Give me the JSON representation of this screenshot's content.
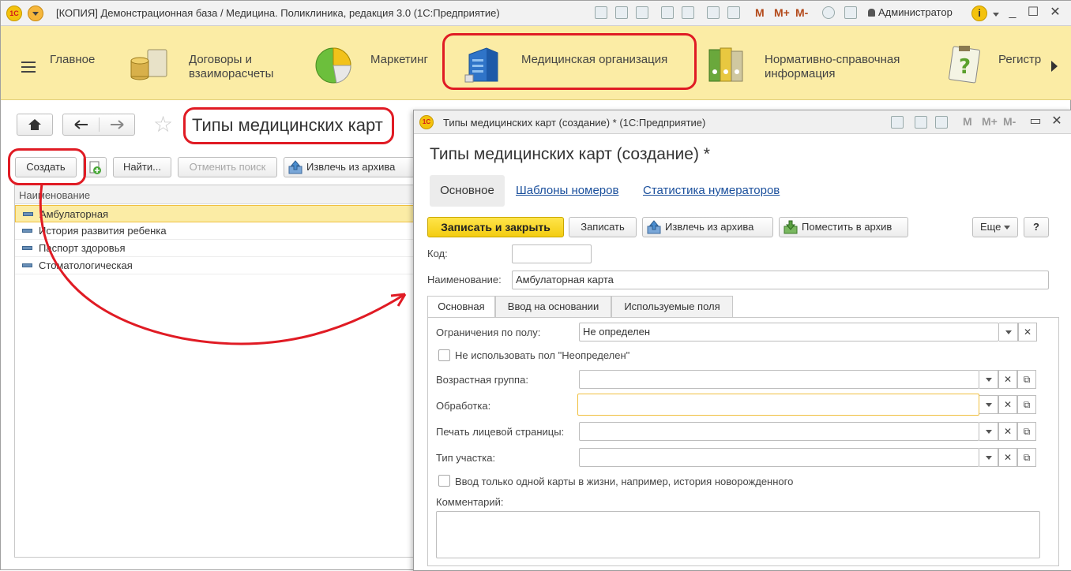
{
  "window": {
    "title": "[КОПИЯ] Демонстрационная база / Медицина. Поликлиника, редакция 3.0  (1С:Предприятие)",
    "user": "Администратор",
    "m_labels": [
      "M",
      "M+",
      "M-"
    ]
  },
  "sections": {
    "items": [
      {
        "label_line1": "Главное",
        "label_line2": ""
      },
      {
        "label_line1": "Договоры и",
        "label_line2": "взаиморасчеты"
      },
      {
        "label_line1": "Маркетинг",
        "label_line2": ""
      },
      {
        "label_line1": "Медицинская организация",
        "label_line2": ""
      },
      {
        "label_line1": "Нормативно-справочная",
        "label_line2": "информация"
      },
      {
        "label_line1": "Регистр",
        "label_line2": ""
      }
    ]
  },
  "list": {
    "title": "Типы медицинских карт",
    "buttons": {
      "create": "Создать",
      "find": "Найти...",
      "cancel_search": "Отменить поиск",
      "restore": "Извлечь из архива"
    },
    "column": "Наименование",
    "rows": [
      "Амбулаторная",
      "История развития ребенка",
      "Паспорт здоровья",
      "Стоматологическая"
    ]
  },
  "form": {
    "window_title": "Типы медицинских карт (создание) * (1С:Предприятие)",
    "m_labels": [
      "M",
      "M+",
      "M-"
    ],
    "heading": "Типы медицинских карт (создание) *",
    "nav_tabs": [
      "Основное",
      "Шаблоны номеров",
      "Статистика нумераторов"
    ],
    "buttons": {
      "save_close": "Записать и закрыть",
      "save": "Записать",
      "restore": "Извлечь из архива",
      "archive": "Поместить в архив",
      "more": "Еще",
      "help": "?"
    },
    "code_label": "Код:",
    "code_value": "",
    "name_label": "Наименование:",
    "name_value": "Амбулаторная карта",
    "page_tabs": [
      "Основная",
      "Ввод на основании",
      "Используемые поля"
    ],
    "gender_label": "Ограничения по полу:",
    "gender_value": "Не определен",
    "chk_undefined": "Не использовать пол \"Неопределен\"",
    "age_label": "Возрастная группа:",
    "processing_label": "Обработка:",
    "print_label": "Печать лицевой страницы:",
    "area_label": "Тип участка:",
    "chk_one_card": "Ввод только одной карты в жизни, например, история новорожденного",
    "comment_label": "Комментарий:"
  },
  "colors": {
    "sections_bg": "#fbeca5",
    "accent_yellow": "#f3cc12",
    "annotation_red": "#e01b24",
    "link_blue": "#1a4f9c"
  }
}
